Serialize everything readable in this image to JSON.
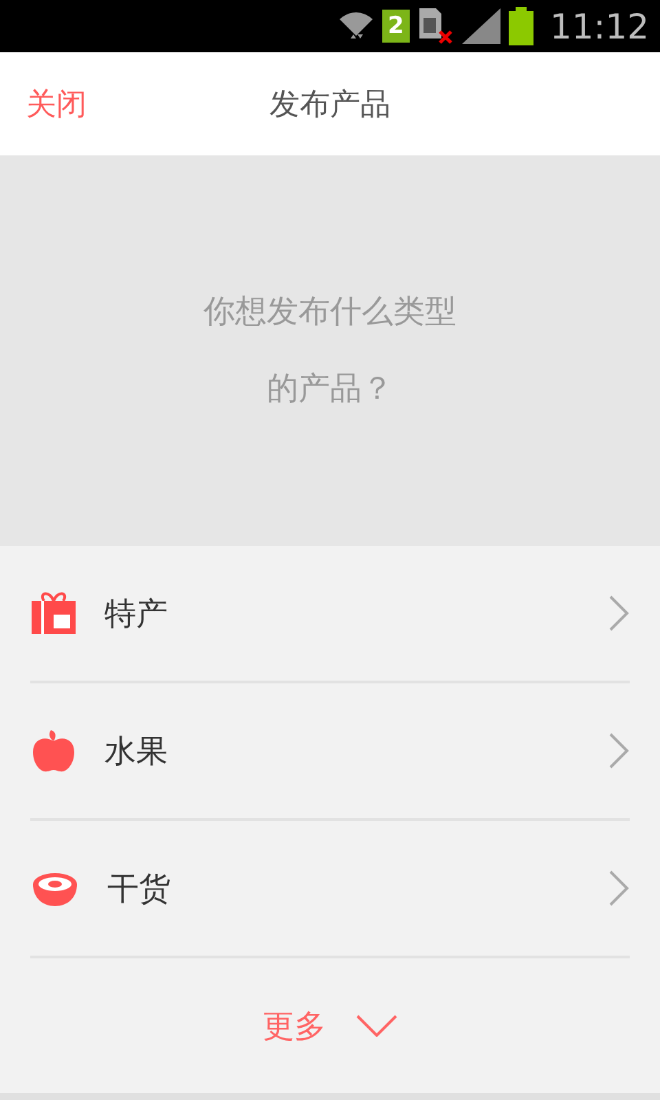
{
  "status_bar": {
    "sim_badge": "2",
    "time": "11:12"
  },
  "header": {
    "close": "关闭",
    "title": "发布产品"
  },
  "prompt": "你想发布什么类型的产品？",
  "categories": [
    {
      "kind": "gift",
      "label": "特产"
    },
    {
      "kind": "apple",
      "label": "水果"
    },
    {
      "kind": "bowl",
      "label": "干货"
    }
  ],
  "more": "更多"
}
